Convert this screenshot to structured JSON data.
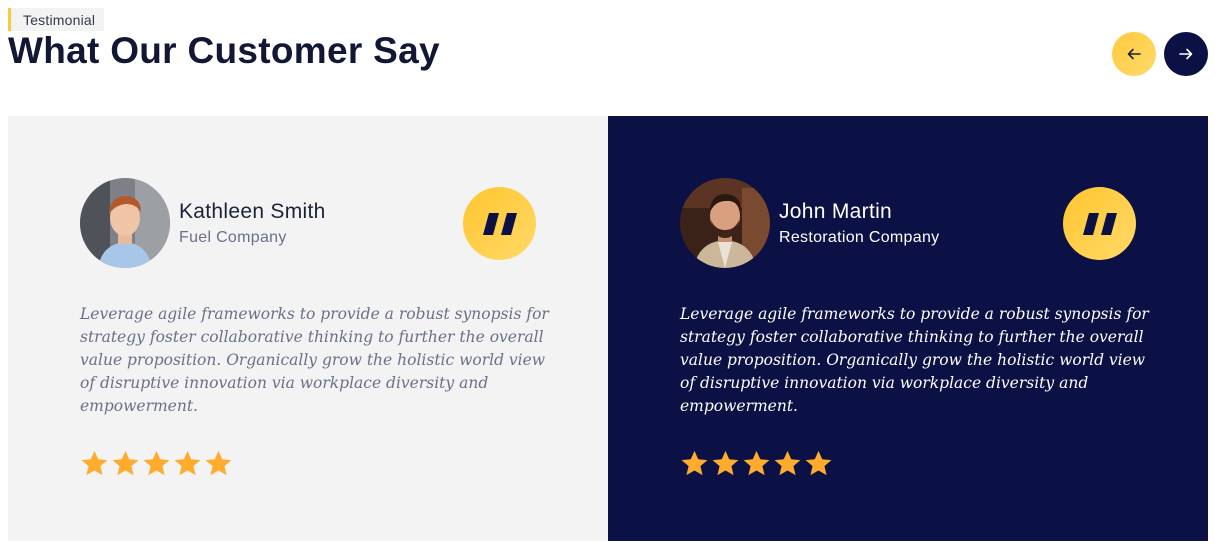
{
  "section": {
    "tag": "Testimonial",
    "title": "What Our Customer Say"
  },
  "nav": {
    "prev_icon": "arrow-left-icon",
    "next_icon": "arrow-right-icon"
  },
  "colors": {
    "accent": "#ffc93c",
    "dark_navy": "#0b1145",
    "light_card": "#f3f3f3",
    "star": "#ffab2e"
  },
  "testimonials": [
    {
      "name": "Kathleen Smith",
      "company": "Fuel Company",
      "text": "Leverage agile frameworks to provide a robust synopsis for strategy foster collaborative thinking to further the overall value proposition. Organically grow the holistic world view of disruptive innovation via workplace diversity and empowerment.",
      "rating": 5,
      "rating_max": 5,
      "theme": "light"
    },
    {
      "name": "John Martin",
      "company": "Restoration Company",
      "text": "Leverage agile frameworks to provide a robust synopsis for strategy foster collaborative thinking to further the overall value proposition. Organically grow the holistic world view of disruptive innovation via workplace diversity and empowerment.",
      "rating": 5,
      "rating_max": 5,
      "theme": "dark"
    }
  ]
}
